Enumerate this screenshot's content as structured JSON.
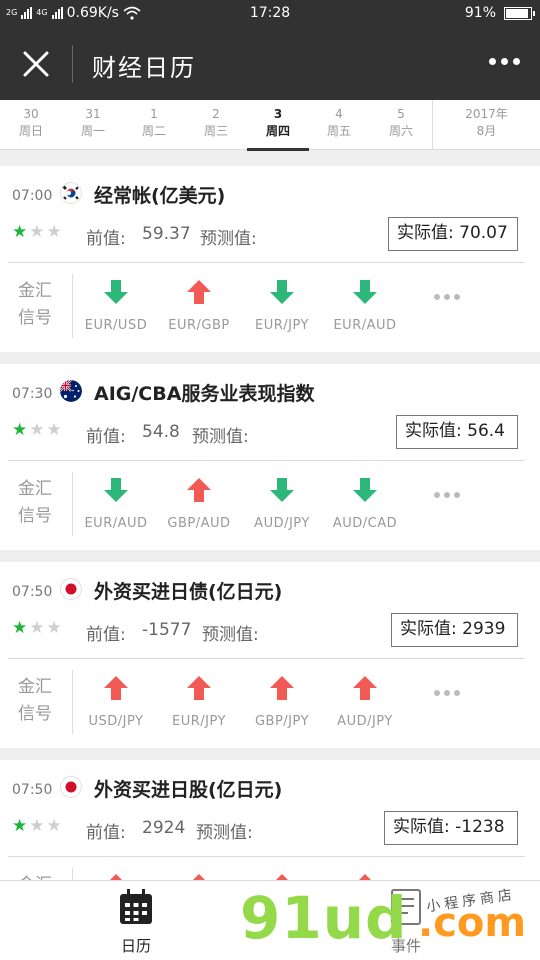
{
  "status": {
    "signal_a": "2G",
    "signal_b": "4G",
    "speed": "0.69K/s",
    "time": "17:28",
    "battery": "91%",
    "battery_level": 0.91
  },
  "nav": {
    "title": "财经日历"
  },
  "dates": [
    {
      "day": "30",
      "weekday": "周日"
    },
    {
      "day": "31",
      "weekday": "周一"
    },
    {
      "day": "1",
      "weekday": "周二"
    },
    {
      "day": "2",
      "weekday": "周三"
    },
    {
      "day": "3",
      "weekday": "周四",
      "active": true
    },
    {
      "day": "4",
      "weekday": "周五"
    },
    {
      "day": "5",
      "weekday": "周六"
    }
  ],
  "month": {
    "year": "2017年",
    "month": "8月"
  },
  "labels": {
    "previous": "前值:",
    "forecast": "预测值:",
    "actual": "实际值:",
    "signal_line1": "金汇",
    "signal_line2": "信号"
  },
  "events": [
    {
      "time": "07:00",
      "country": "korea-flag",
      "title": "经常帐(亿美元)",
      "stars": 1,
      "previous": "59.37",
      "forecast": "",
      "actual": "70.07",
      "pairs": [
        {
          "name": "EUR/USD",
          "direction": "down"
        },
        {
          "name": "EUR/GBP",
          "direction": "up"
        },
        {
          "name": "EUR/JPY",
          "direction": "down"
        },
        {
          "name": "EUR/AUD",
          "direction": "down"
        }
      ]
    },
    {
      "time": "07:30",
      "country": "australia-flag",
      "title": "AIG/CBA服务业表现指数",
      "stars": 1,
      "previous": "54.8",
      "forecast": "",
      "actual": "56.4",
      "pairs": [
        {
          "name": "EUR/AUD",
          "direction": "down"
        },
        {
          "name": "GBP/AUD",
          "direction": "up"
        },
        {
          "name": "AUD/JPY",
          "direction": "down"
        },
        {
          "name": "AUD/CAD",
          "direction": "down"
        }
      ]
    },
    {
      "time": "07:50",
      "country": "japan-flag",
      "title": "外资买进日债(亿日元)",
      "stars": 1,
      "previous": "-1577",
      "forecast": "",
      "actual": "2939",
      "pairs": [
        {
          "name": "USD/JPY",
          "direction": "up"
        },
        {
          "name": "EUR/JPY",
          "direction": "up"
        },
        {
          "name": "GBP/JPY",
          "direction": "up"
        },
        {
          "name": "AUD/JPY",
          "direction": "up"
        }
      ]
    },
    {
      "time": "07:50",
      "country": "japan-flag",
      "title": "外资买进日股(亿日元)",
      "stars": 1,
      "previous": "2924",
      "forecast": "",
      "actual": "-1238",
      "pairs": [
        {
          "name": "",
          "direction": "up"
        },
        {
          "name": "",
          "direction": "up"
        },
        {
          "name": "",
          "direction": "up"
        },
        {
          "name": "",
          "direction": "up"
        }
      ]
    }
  ],
  "colors": {
    "up": "#f25a55",
    "down": "#2db77a",
    "star_on": "#1fb53b",
    "header": "#323232"
  },
  "tabs": {
    "calendar": "日历",
    "events": "事件"
  },
  "watermark": {
    "main": "91ud",
    "com": ".com",
    "sub": "小程序商店"
  }
}
